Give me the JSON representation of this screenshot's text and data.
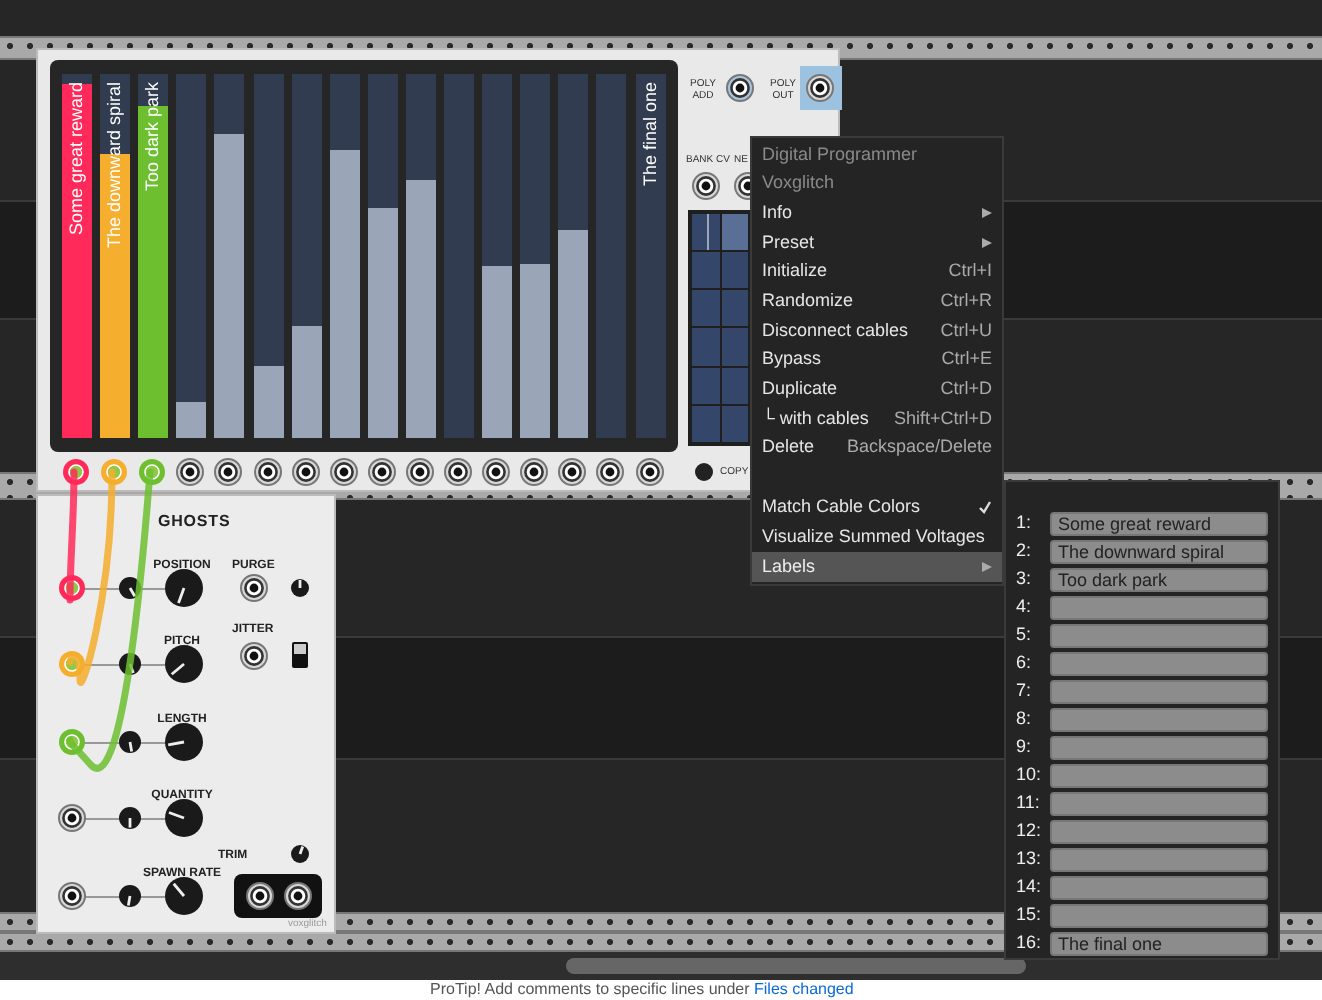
{
  "digital_programmer": {
    "sliders": [
      {
        "level": 0.97,
        "color": "#ff2a5a",
        "label": "Some great reward"
      },
      {
        "level": 0.78,
        "color": "#f5ae2d",
        "label": "The downward spiral"
      },
      {
        "level": 0.91,
        "color": "#6dbf30",
        "label": "Too dark park"
      },
      {
        "level": 0.1
      },
      {
        "level": 0.835
      },
      {
        "level": 0.2
      },
      {
        "level": 0.31
      },
      {
        "level": 0.79
      },
      {
        "level": 0.63
      },
      {
        "level": 0.71
      },
      {
        "level": 0.0
      },
      {
        "level": 0.47
      },
      {
        "level": 0.48
      },
      {
        "level": 0.57
      },
      {
        "level": 0.0
      },
      {
        "level": 0.0,
        "label": "The final one"
      }
    ],
    "output_jacks": [
      {
        "plugged": true,
        "color": "#ff2a5a"
      },
      {
        "plugged": true,
        "color": "#f5ae2d"
      },
      {
        "plugged": true,
        "color": "#6dbf30"
      },
      {
        "plugged": false
      },
      {
        "plugged": false
      },
      {
        "plugged": false
      },
      {
        "plugged": false
      },
      {
        "plugged": false
      },
      {
        "plugged": false
      },
      {
        "plugged": false
      },
      {
        "plugged": false
      },
      {
        "plugged": false
      },
      {
        "plugged": false
      },
      {
        "plugged": false
      },
      {
        "plugged": false
      },
      {
        "plugged": false
      }
    ],
    "poly_add_label": [
      "POLY",
      "ADD"
    ],
    "poly_out_label": [
      "POLY",
      "OUT"
    ],
    "bank_cv_label": "BANK CV",
    "next_label": "NE",
    "copy_label": "COPY"
  },
  "context_menu": {
    "items": [
      {
        "kind": "header",
        "label": "Digital Programmer"
      },
      {
        "kind": "header",
        "label": "Voxglitch"
      },
      {
        "kind": "submenu",
        "label": "Info",
        "selected": false
      },
      {
        "kind": "submenu",
        "label": "Preset",
        "selected": false
      },
      {
        "kind": "action",
        "label": "Initialize",
        "shortcut": "Ctrl+I",
        "selected": false
      },
      {
        "kind": "action",
        "label": "Randomize",
        "shortcut": "Ctrl+R",
        "selected": false
      },
      {
        "kind": "action",
        "label": "Disconnect cables",
        "shortcut": "Ctrl+U",
        "selected": false
      },
      {
        "kind": "action",
        "label": "Bypass",
        "shortcut": "Ctrl+E",
        "selected": false
      },
      {
        "kind": "action",
        "label": "Duplicate",
        "shortcut": "Ctrl+D",
        "selected": false
      },
      {
        "kind": "action",
        "label": "└ with cables",
        "shortcut": "Shift+Ctrl+D",
        "selected": false
      },
      {
        "kind": "action",
        "label": "Delete",
        "shortcut": "Backspace/Delete",
        "selected": false
      },
      {
        "kind": "separator"
      },
      {
        "kind": "toggle",
        "label": "Match Cable Colors",
        "checked": true,
        "selected": false
      },
      {
        "kind": "toggle",
        "label": "Visualize Summed Voltages",
        "checked": false,
        "selected": false
      },
      {
        "kind": "submenu",
        "label": "Labels",
        "selected": true
      }
    ]
  },
  "labels_submenu": {
    "rows": [
      {
        "number": "1:",
        "value": "Some great reward"
      },
      {
        "number": "2:",
        "value": "The downward spiral"
      },
      {
        "number": "3:",
        "value": "Too dark park"
      },
      {
        "number": "4:"
      },
      {
        "number": "5:"
      },
      {
        "number": "6:"
      },
      {
        "number": "7:"
      },
      {
        "number": "8:"
      },
      {
        "number": "9:"
      },
      {
        "number": "10:"
      },
      {
        "number": "11:"
      },
      {
        "number": "12:"
      },
      {
        "number": "13:"
      },
      {
        "number": "14:"
      },
      {
        "number": "15:"
      },
      {
        "number": "16:",
        "value": "The final one"
      }
    ]
  },
  "ghosts": {
    "title": "GHOSTS",
    "rows": [
      {
        "label": "POSITION",
        "plugged": true,
        "color": "#ff2a5a"
      },
      {
        "label": "PITCH",
        "plugged": true,
        "color": "#f5ae2d"
      },
      {
        "label": "LENGTH",
        "plugged": true,
        "color": "#6dbf30"
      },
      {
        "label": "QUANTITY",
        "plugged": false
      },
      {
        "label": "SPAWN RATE",
        "plugged": false
      }
    ],
    "purge_label": "PURGE",
    "jitter_label": "JITTER",
    "jitter_on": true,
    "trim_label": "TRIM",
    "brand": "voxglitch"
  },
  "footer": {
    "text": "ProTip! Add comments to specific lines under ",
    "link": "Files changed"
  }
}
